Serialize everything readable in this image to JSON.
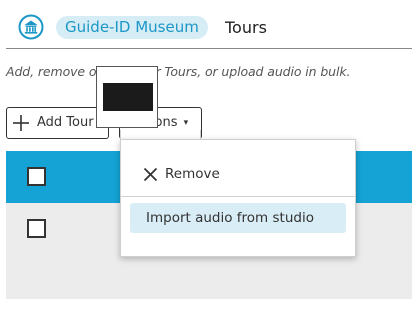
{
  "header": {
    "museum_name": "Guide-ID Museum",
    "page_title": "Tours",
    "logo_icon": "museum-building-icon"
  },
  "subtitle": "Add, remove or edit your Tours, or upload audio in bulk.",
  "toolbar": {
    "add_label": "Add Tour",
    "actions_label": "Actions",
    "actions_caret": "▾"
  },
  "actions_menu": {
    "remove_label": "Remove",
    "import_label": "Import audio from studio"
  },
  "colors": {
    "accent": "#14a3d4",
    "pill_bg": "#d6edf5",
    "highlight_bg": "#d8edf5"
  }
}
